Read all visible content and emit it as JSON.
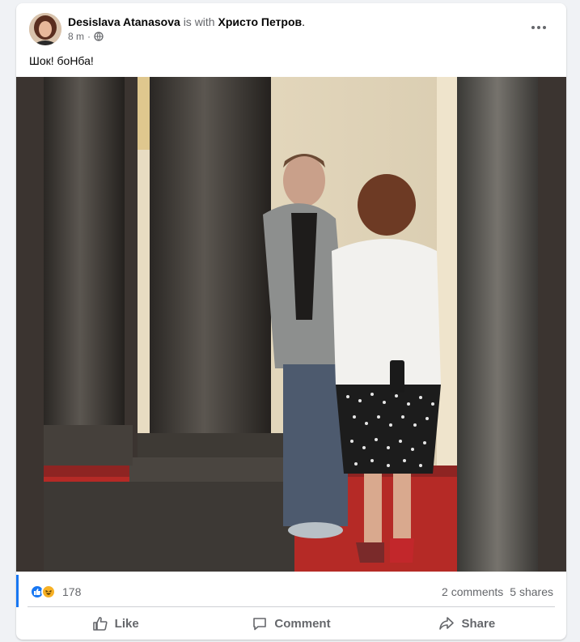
{
  "post": {
    "author": "Desislava Atanasova",
    "with_text": "is with",
    "tagged": "Христо Петров",
    "tagged_suffix": ".",
    "time": "8 m",
    "separator": "·",
    "text": "Шок! боНба!"
  },
  "stats": {
    "reaction_count": "178",
    "comments": "2 comments",
    "shares": "5 shares"
  },
  "actions": {
    "like": "Like",
    "comment": "Comment",
    "share": "Share"
  },
  "icons": {
    "more": "more-horizontal-icon",
    "privacy": "globe-icon",
    "like": "thumbs-up-icon",
    "comment": "comment-bubble-icon",
    "share": "share-arrow-icon"
  },
  "colors": {
    "accent": "#1877f2",
    "muted": "#65676b",
    "haha": "#f7b125"
  }
}
